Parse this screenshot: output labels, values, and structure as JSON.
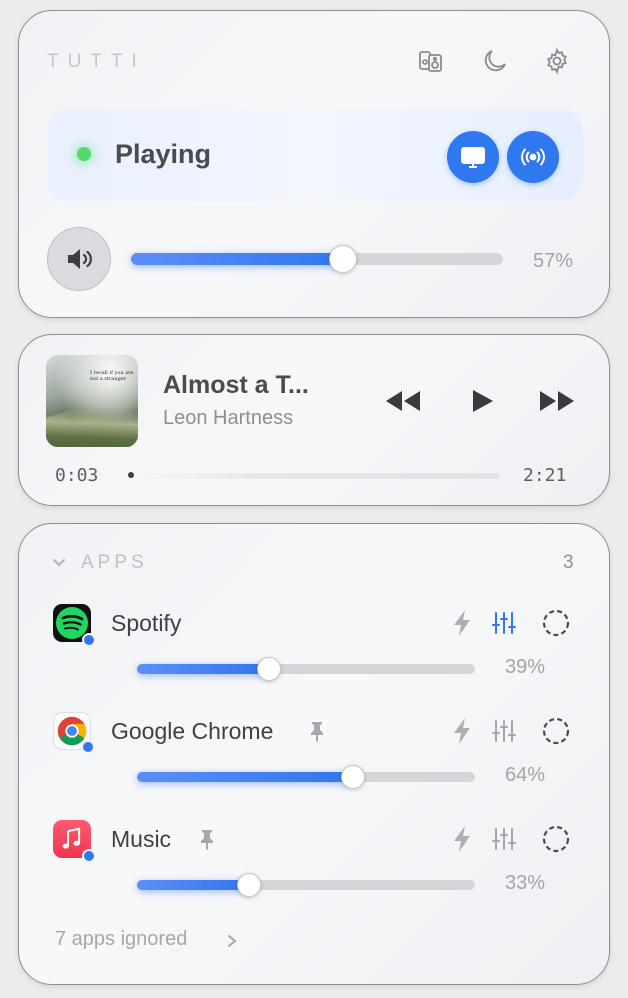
{
  "header": {
    "brand": "TUTTI",
    "icons": [
      "audio-devices-icon",
      "moon-icon",
      "gear-icon"
    ]
  },
  "status": {
    "label": "Playing",
    "indicator_color": "#58d86a",
    "buttons": [
      "display-icon",
      "airplay-broadcast-icon"
    ]
  },
  "master_volume": {
    "icon": "speaker-icon",
    "value_percent": 57,
    "label": "57%"
  },
  "now_playing": {
    "title": "Almost a T...",
    "artist": "Leon Hartness",
    "album_art_text": "I recall if you are not a stranger",
    "elapsed": "0:03",
    "total": "2:21",
    "controls": [
      "rewind-icon",
      "play-icon",
      "fast-forward-icon"
    ]
  },
  "apps": {
    "title": "APPS",
    "count": "3",
    "items": [
      {
        "name": "Spotify",
        "icon": "spotify-icon",
        "pinned": false,
        "eq_active": true,
        "volume_percent": 39,
        "label": "39%"
      },
      {
        "name": "Google Chrome",
        "icon": "chrome-icon",
        "pinned": true,
        "eq_active": false,
        "volume_percent": 64,
        "label": "64%"
      },
      {
        "name": "Music",
        "icon": "music-icon",
        "pinned": true,
        "eq_active": false,
        "volume_percent": 33,
        "label": "33%"
      }
    ],
    "ignored_label": "7 apps ignored"
  },
  "colors": {
    "accent": "#2f78f0",
    "status_green": "#58d86a"
  }
}
